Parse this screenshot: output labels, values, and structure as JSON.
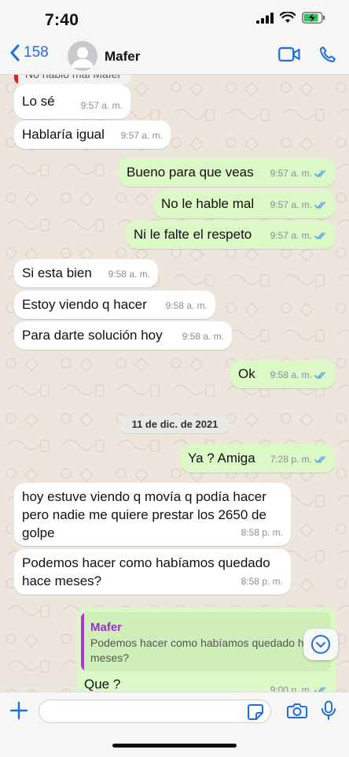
{
  "status_bar": {
    "time": "7:40"
  },
  "header": {
    "back_count": "158",
    "contact_name": "Mafer"
  },
  "quoted_top": "No hablo mal Mafer",
  "messages": [
    {
      "text": "Lo sé",
      "time": "9:57 a. m."
    },
    {
      "text": "Hablaría igual",
      "time": "9:57 a. m."
    },
    {
      "text": "Bueno para que veas",
      "time": "9:57 a. m."
    },
    {
      "text": "No le hable mal",
      "time": "9:57 a. m."
    },
    {
      "text": "Ni le falte el respeto",
      "time": "9:57 a. m."
    },
    {
      "text": "Si esta bien",
      "time": "9:58 a. m."
    },
    {
      "text": "Estoy viendo q hacer",
      "time": "9:58 a. m."
    },
    {
      "text": "Para darte solución hoy",
      "time": "9:58 a. m."
    },
    {
      "text": "Ok",
      "time": "9:58 a. m."
    },
    {
      "text": "Ya ? Amiga",
      "time": "7:28 p. m."
    },
    {
      "text": "hoy estuve viendo q movía q podía hacer pero nadie me quiere prestar los 2650 de golpe",
      "time": "8:58 p. m."
    },
    {
      "text": "Podemos hacer como habíamos quedado hace meses?",
      "time": "8:58 p. m."
    },
    {
      "text": "Que ?",
      "time": "9:00 p. m."
    }
  ],
  "date_separator": "11 de dic. de 2021",
  "reply_quote": {
    "name": "Mafer",
    "text": "Podemos hacer como habíamos quedado hace meses?"
  },
  "input": {
    "placeholder": "",
    "value": ""
  },
  "colors": {
    "accent": "#1d6fe0",
    "outgoing": "#dcf8c6",
    "incoming": "#ffffff",
    "check": "#4fa3e6",
    "reply_name": "#9a2fd0"
  },
  "icons": [
    "back-chevron-icon",
    "video-call-icon",
    "phone-icon",
    "double-check-icon",
    "chevron-down-icon",
    "plus-icon",
    "sticker-icon",
    "camera-icon",
    "microphone-icon"
  ]
}
